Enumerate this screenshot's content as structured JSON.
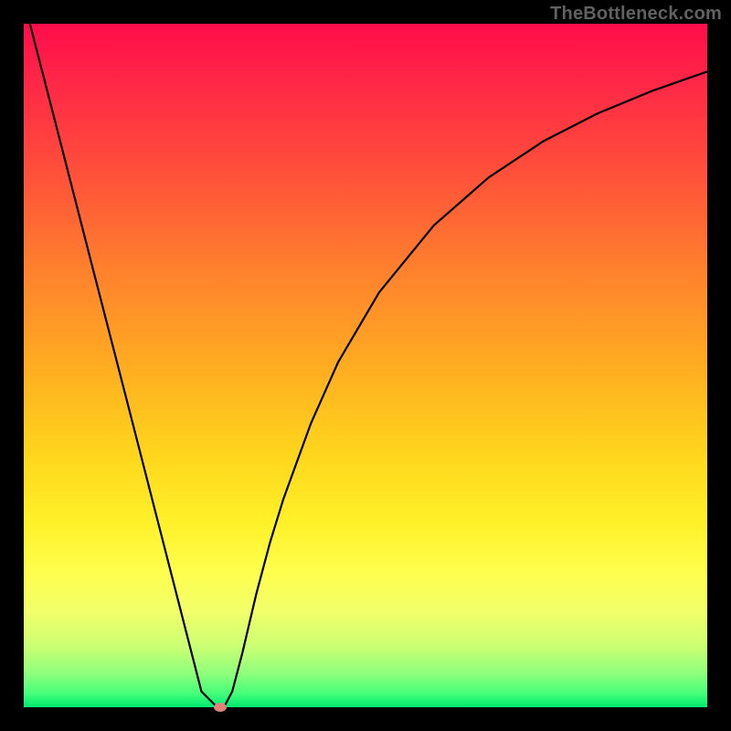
{
  "attribution": "TheBottleneck.com",
  "chart_data": {
    "type": "line",
    "title": "",
    "xlabel": "",
    "ylabel": "",
    "xlim": [
      0,
      100
    ],
    "ylim": [
      0,
      100
    ],
    "grid": false,
    "series": [
      {
        "name": "curve",
        "color": "#000000",
        "x": [
          0.9,
          5,
          10,
          15,
          20,
          24,
          26,
          28,
          28.7,
          29.5,
          30.5,
          32,
          34,
          36,
          38,
          42,
          46,
          52,
          60,
          68,
          76,
          84,
          92,
          100
        ],
        "values": [
          100,
          84.1,
          64.6,
          45.2,
          25.7,
          10.1,
          2.3,
          0.3,
          0.0,
          0.4,
          2.3,
          8.0,
          16.5,
          24.0,
          30.5,
          41.5,
          50.5,
          60.7,
          70.5,
          77.5,
          82.8,
          86.9,
          90.2,
          93.0
        ]
      }
    ],
    "marker": {
      "x": 28.7,
      "y": 0.0,
      "color": "#e2817a"
    }
  }
}
